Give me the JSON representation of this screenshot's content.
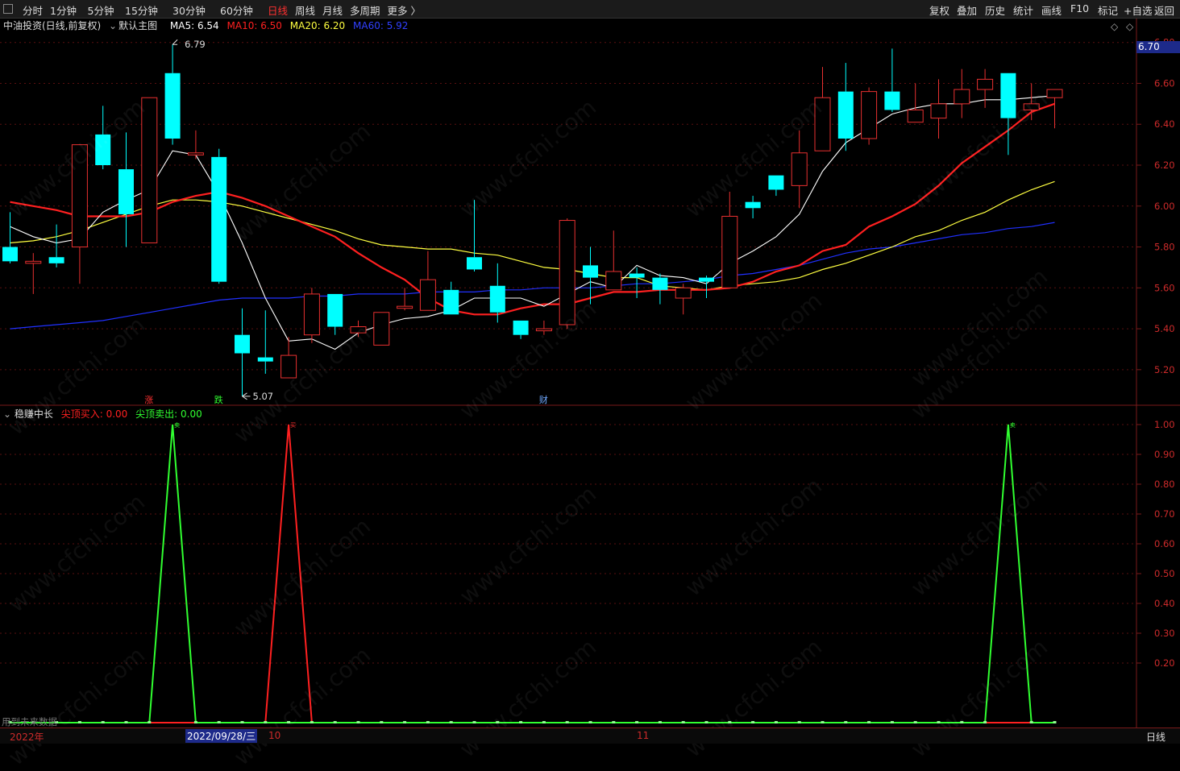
{
  "toolbar": {
    "periods": [
      "分时",
      "1分钟",
      "5分钟",
      "15分钟",
      "30分钟",
      "60分钟",
      "日线",
      "周线",
      "月线",
      "多周期",
      "更多 〉"
    ],
    "active_period": "日线",
    "right_buttons": [
      "复权",
      "叠加",
      "历史",
      "统计",
      "画线",
      "F10",
      "标记",
      "+自选",
      "返回"
    ]
  },
  "main_info": {
    "stock": "中油投资(日线,前复权)",
    "template": "默认主图",
    "ma5": "MA5: 6.54",
    "ma10": "MA10: 6.50",
    "ma20": "MA20: 6.20",
    "ma60": "MA60: 5.92"
  },
  "sub_info": {
    "name": "稳赚中长",
    "buy": "尖顶买入: 0.00",
    "sell": "尖顶卖出: 0.00"
  },
  "price_tag": "6.70",
  "annotations": {
    "high": "6.79",
    "low": "5.07"
  },
  "markers": [
    "涨",
    "跌",
    "财"
  ],
  "bottom": {
    "left_note": "用到未来数据",
    "year": "2022年",
    "cursor_date": "2022/09/28/三",
    "month1": "10",
    "month2": "11",
    "period": "日线"
  },
  "watermark": "www.cfchi.com",
  "colors": {
    "up": "#e83030",
    "down": "#00ffff",
    "ma5": "#ffffff",
    "ma10": "#ff2020",
    "ma20": "#ffff40",
    "ma60": "#2030ff",
    "buy": "#ff2020",
    "sell": "#30ff30"
  },
  "chart_data": [
    {
      "type": "candlestick",
      "ylabels": [
        "6.80",
        "6.60",
        "6.40",
        "6.20",
        "6.00",
        "5.80",
        "5.60",
        "5.40",
        "5.20"
      ],
      "ylim": [
        5.03,
        6.85
      ],
      "candles": [
        [
          5.8,
          5.73,
          5.97,
          5.72
        ],
        [
          5.72,
          5.73,
          5.77,
          5.57
        ],
        [
          5.75,
          5.72,
          5.91,
          5.7
        ],
        [
          5.8,
          6.3,
          6.3,
          5.62
        ],
        [
          6.35,
          6.2,
          6.49,
          6.18
        ],
        [
          6.18,
          5.96,
          6.36,
          5.8
        ],
        [
          5.82,
          6.53,
          6.53,
          5.82
        ],
        [
          6.65,
          6.33,
          6.79,
          6.3
        ],
        [
          6.25,
          6.26,
          6.37,
          6.23
        ],
        [
          6.24,
          5.63,
          6.28,
          5.62
        ],
        [
          5.37,
          5.28,
          5.5,
          5.07
        ],
        [
          5.26,
          5.24,
          5.49,
          5.18
        ],
        [
          5.16,
          5.27,
          5.36,
          5.16
        ],
        [
          5.37,
          5.57,
          5.6,
          5.33
        ],
        [
          5.57,
          5.41,
          5.57,
          5.37
        ],
        [
          5.38,
          5.41,
          5.44,
          5.36
        ],
        [
          5.32,
          5.48,
          5.48,
          5.32
        ],
        [
          5.5,
          5.51,
          5.6,
          5.49
        ],
        [
          5.49,
          5.64,
          5.78,
          5.49
        ],
        [
          5.59,
          5.47,
          5.63,
          5.47
        ],
        [
          5.75,
          5.69,
          6.03,
          5.68
        ],
        [
          5.61,
          5.48,
          5.72,
          5.43
        ],
        [
          5.44,
          5.37,
          5.44,
          5.35
        ],
        [
          5.39,
          5.4,
          5.44,
          5.37
        ],
        [
          5.42,
          5.93,
          5.94,
          5.4
        ],
        [
          5.71,
          5.65,
          5.8,
          5.52
        ],
        [
          5.59,
          5.68,
          5.88,
          5.59
        ],
        [
          5.67,
          5.65,
          5.7,
          5.55
        ],
        [
          5.65,
          5.59,
          5.67,
          5.52
        ],
        [
          5.55,
          5.6,
          5.62,
          5.47
        ],
        [
          5.65,
          5.63,
          5.66,
          5.55
        ],
        [
          5.6,
          5.95,
          6.07,
          5.6
        ],
        [
          6.02,
          5.99,
          6.05,
          5.94
        ],
        [
          6.15,
          6.08,
          6.15,
          6.05
        ],
        [
          6.1,
          6.26,
          6.37,
          5.99
        ],
        [
          6.27,
          6.53,
          6.68,
          6.27
        ],
        [
          6.56,
          6.33,
          6.7,
          6.27
        ],
        [
          6.33,
          6.56,
          6.58,
          6.3
        ],
        [
          6.56,
          6.47,
          6.77,
          6.46
        ],
        [
          6.41,
          6.47,
          6.6,
          6.41
        ],
        [
          6.43,
          6.5,
          6.62,
          6.33
        ],
        [
          6.5,
          6.57,
          6.67,
          6.43
        ],
        [
          6.57,
          6.62,
          6.67,
          6.48
        ],
        [
          6.65,
          6.43,
          6.65,
          6.25
        ],
        [
          6.47,
          6.5,
          6.6,
          6.42
        ],
        [
          6.53,
          6.57,
          6.57,
          6.38
        ]
      ],
      "ma5": [
        5.9,
        5.85,
        5.82,
        5.84,
        5.97,
        6.03,
        6.08,
        6.27,
        6.25,
        6.06,
        5.82,
        5.55,
        5.34,
        5.35,
        5.3,
        5.38,
        5.42,
        5.45,
        5.46,
        5.49,
        5.55,
        5.55,
        5.55,
        5.51,
        5.57,
        5.63,
        5.6,
        5.71,
        5.66,
        5.65,
        5.62,
        5.72,
        5.78,
        5.85,
        5.96,
        6.17,
        6.31,
        6.38,
        6.45,
        6.48,
        6.5,
        6.5,
        6.52,
        6.52,
        6.53,
        6.54
      ],
      "ma10": [
        6.02,
        6.0,
        5.98,
        5.95,
        5.95,
        5.95,
        5.97,
        6.02,
        6.05,
        6.07,
        6.04,
        6.0,
        5.95,
        5.9,
        5.85,
        5.77,
        5.7,
        5.64,
        5.55,
        5.49,
        5.47,
        5.47,
        5.5,
        5.52,
        5.52,
        5.55,
        5.58,
        5.58,
        5.59,
        5.59,
        5.59,
        5.6,
        5.63,
        5.68,
        5.71,
        5.78,
        5.81,
        5.9,
        5.95,
        6.01,
        6.1,
        6.21,
        6.29,
        6.37,
        6.46,
        6.5
      ],
      "ma20": [
        5.82,
        5.83,
        5.85,
        5.88,
        5.92,
        5.96,
        6.0,
        6.03,
        6.03,
        6.02,
        6.0,
        5.97,
        5.94,
        5.91,
        5.88,
        5.84,
        5.81,
        5.8,
        5.79,
        5.79,
        5.77,
        5.76,
        5.73,
        5.7,
        5.69,
        5.67,
        5.65,
        5.65,
        5.61,
        5.6,
        5.59,
        5.61,
        5.62,
        5.63,
        5.65,
        5.69,
        5.72,
        5.76,
        5.8,
        5.85,
        5.88,
        5.93,
        5.97,
        6.03,
        6.08,
        6.12,
        6.15,
        6.2
      ],
      "ma60": [
        5.4,
        5.41,
        5.42,
        5.43,
        5.44,
        5.46,
        5.48,
        5.5,
        5.52,
        5.54,
        5.55,
        5.55,
        5.55,
        5.56,
        5.56,
        5.57,
        5.57,
        5.57,
        5.58,
        5.58,
        5.58,
        5.59,
        5.59,
        5.6,
        5.6,
        5.6,
        5.61,
        5.62,
        5.62,
        5.63,
        5.64,
        5.66,
        5.67,
        5.69,
        5.71,
        5.74,
        5.77,
        5.79,
        5.8,
        5.82,
        5.84,
        5.86,
        5.87,
        5.89,
        5.9,
        5.92
      ]
    },
    {
      "type": "line",
      "ylabels": [
        "1.00",
        "0.90",
        "0.80",
        "0.70",
        "0.60",
        "0.50",
        "0.40",
        "0.30",
        "0.20"
      ],
      "ylim": [
        0.0,
        1.0
      ],
      "buy": [
        0,
        0,
        0,
        0,
        0,
        0,
        0,
        0,
        0,
        0,
        0,
        0,
        1,
        0,
        0,
        0,
        0,
        0,
        0,
        0,
        0,
        0,
        0,
        0,
        0,
        0,
        0,
        0,
        0,
        0,
        0,
        0,
        0,
        0,
        0,
        0,
        0,
        0,
        0,
        0,
        0,
        0,
        0,
        0,
        0,
        0
      ],
      "sell": [
        0,
        0,
        0,
        0,
        0,
        0,
        0,
        1,
        0,
        0,
        0,
        0,
        0,
        0,
        0,
        0,
        0,
        0,
        0,
        0,
        0,
        0,
        0,
        0,
        0,
        0,
        0,
        0,
        0,
        0,
        0,
        0,
        0,
        0,
        0,
        0,
        0,
        0,
        0,
        0,
        0,
        0,
        0,
        1,
        0,
        0
      ]
    }
  ]
}
